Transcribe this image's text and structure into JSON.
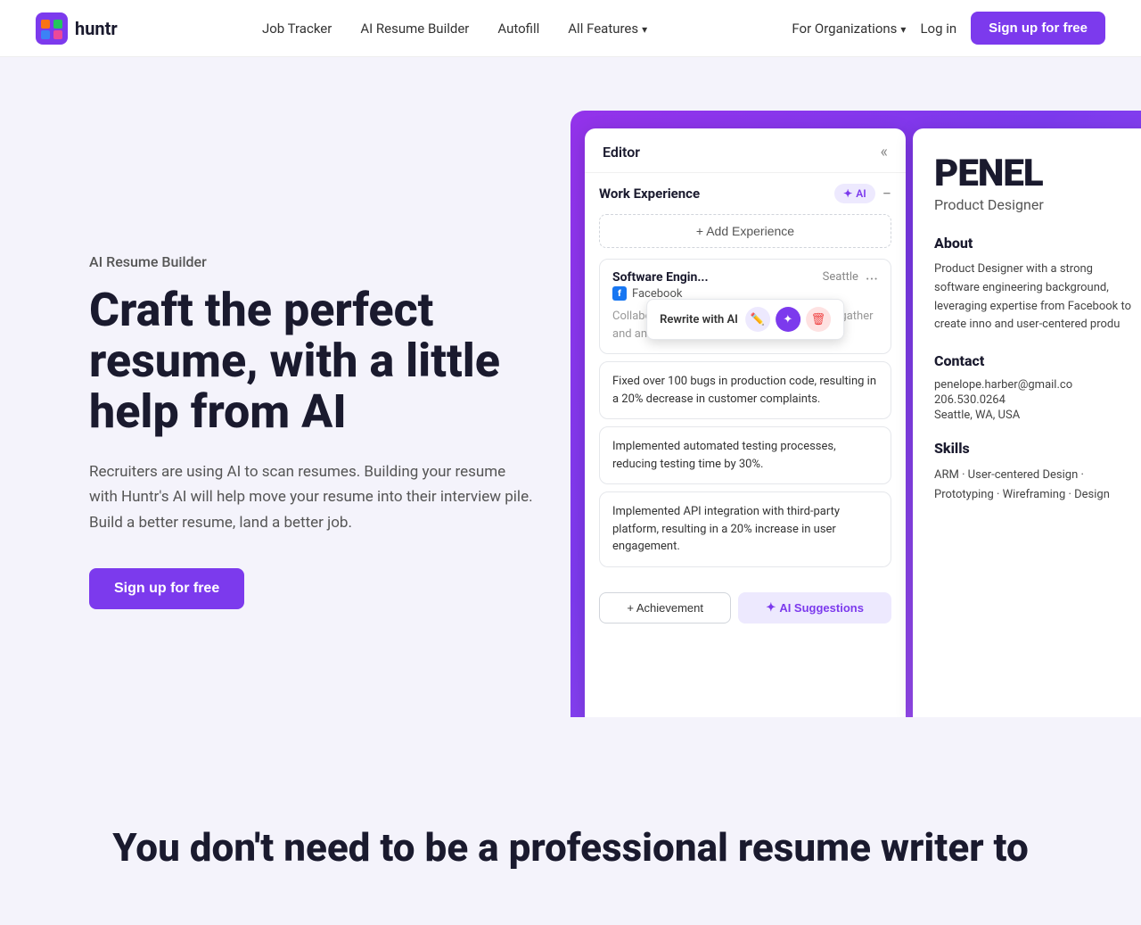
{
  "nav": {
    "logo_text": "huntr",
    "links": [
      {
        "label": "Job Tracker",
        "id": "job-tracker"
      },
      {
        "label": "AI Resume Builder",
        "id": "ai-resume-builder"
      },
      {
        "label": "Autofill",
        "id": "autofill"
      },
      {
        "label": "All Features",
        "id": "all-features",
        "has_dropdown": true
      }
    ],
    "for_orgs_label": "For Organizations",
    "login_label": "Log in",
    "signup_label": "Sign up for free"
  },
  "hero": {
    "subtitle": "AI Resume Builder",
    "title": "Craft the perfect resume, with a little help from AI",
    "description": "Recruiters are using AI to scan resumes. Building your resume with Huntr's AI will help move your resume into their interview pile. Build a better resume, land a better job.",
    "signup_label": "Sign up for free"
  },
  "editor": {
    "title": "Editor",
    "section_title": "Work Experience",
    "ai_badge": "AI",
    "add_exp_label": "+ Add Experience",
    "job_title": "Software Engin...",
    "company": "Facebook",
    "location": "Seattle",
    "rewrite_label": "Rewrite with AI",
    "description_text": "Collaborated with cross-functional teams to gather and analyze industry trends",
    "bullets": [
      "Fixed over 100 bugs in production code, resulting in a 20% decrease in customer complaints.",
      "Implemented automated testing processes, reducing testing time by 30%.",
      "Implemented API integration with third-party platform, resulting in a 20% increase in user engagement."
    ],
    "achievement_btn": "+ Achievement",
    "ai_suggestions_btn": "AI Suggestions"
  },
  "resume": {
    "name": "PENEL",
    "role": "Product Designer",
    "about_title": "About",
    "about_text": "Product Designer with a strong software engineering background, leveraging expertise from Facebook to create inno and user-centered produ",
    "contact_title": "Contact",
    "email": "penelope.harber@gmail.co",
    "phone": "206.530.0264",
    "address": "Seattle, WA, USA",
    "skills_title": "Skills",
    "skills_text": "ARM · User-centered Design · Prototyping · Wireframing · Design"
  },
  "bottom": {
    "title": "You don't need to be a professional resume writer to"
  }
}
